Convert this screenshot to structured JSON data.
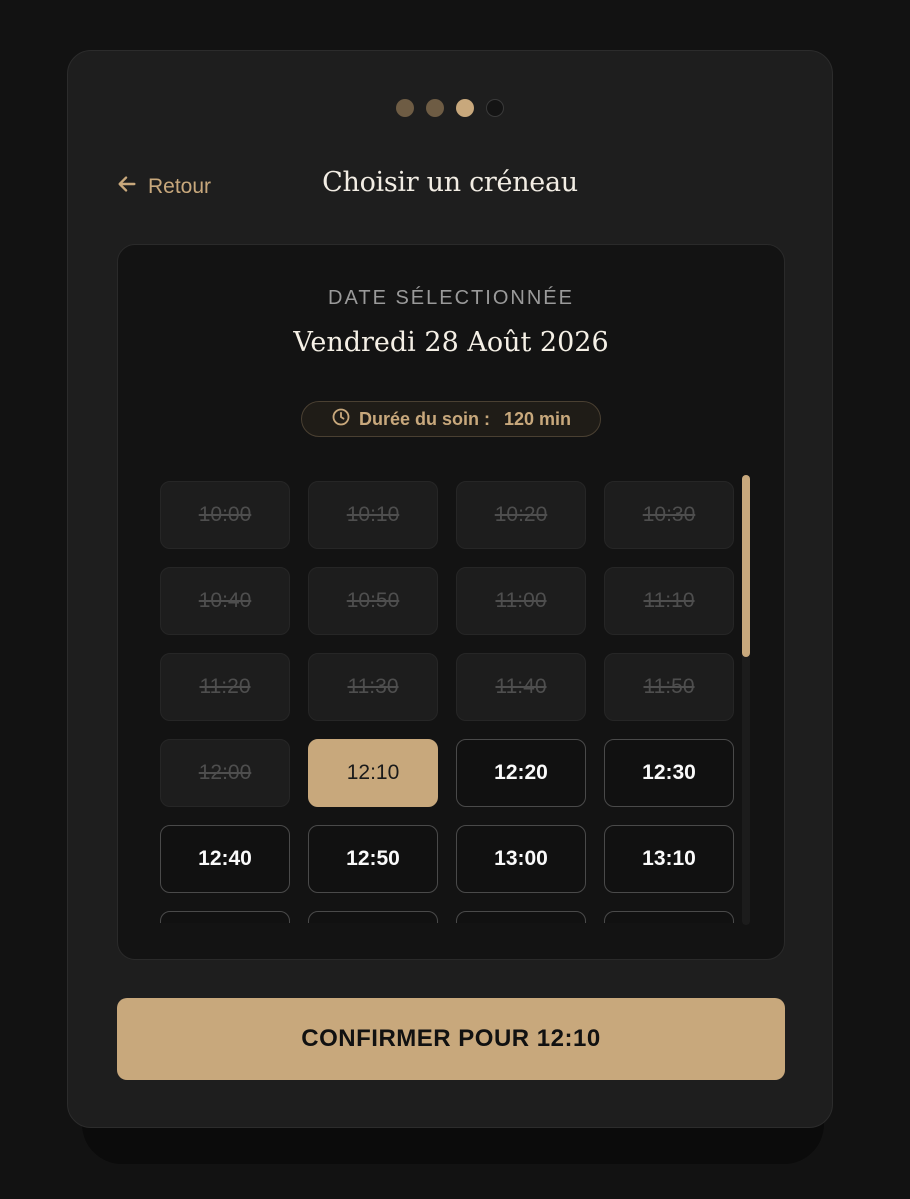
{
  "steps": [
    "done",
    "done",
    "active",
    "todo"
  ],
  "header": {
    "back_label": "Retour",
    "title": "Choisir un créneau"
  },
  "panel": {
    "date_label": "DATE SÉLECTIONNÉE",
    "date_value": "Vendredi 28 Août 2026",
    "duration_label": "Durée du soin :",
    "duration_value": "120 min"
  },
  "slots": [
    {
      "time": "10:00",
      "state": "disabled"
    },
    {
      "time": "10:10",
      "state": "disabled"
    },
    {
      "time": "10:20",
      "state": "disabled"
    },
    {
      "time": "10:30",
      "state": "disabled"
    },
    {
      "time": "10:40",
      "state": "disabled"
    },
    {
      "time": "10:50",
      "state": "disabled"
    },
    {
      "time": "11:00",
      "state": "disabled"
    },
    {
      "time": "11:10",
      "state": "disabled"
    },
    {
      "time": "11:20",
      "state": "disabled"
    },
    {
      "time": "11:30",
      "state": "disabled"
    },
    {
      "time": "11:40",
      "state": "disabled"
    },
    {
      "time": "11:50",
      "state": "disabled"
    },
    {
      "time": "12:00",
      "state": "disabled"
    },
    {
      "time": "12:10",
      "state": "selected"
    },
    {
      "time": "12:20",
      "state": "open"
    },
    {
      "time": "12:30",
      "state": "open"
    },
    {
      "time": "12:40",
      "state": "open"
    },
    {
      "time": "12:50",
      "state": "open"
    },
    {
      "time": "13:00",
      "state": "open"
    },
    {
      "time": "13:10",
      "state": "open"
    },
    {
      "time": "",
      "state": "open"
    },
    {
      "time": "",
      "state": "open"
    },
    {
      "time": "",
      "state": "open"
    },
    {
      "time": "",
      "state": "open"
    }
  ],
  "confirm_label": "CONFIRMER POUR 12:10",
  "colors": {
    "accent": "#c8a87c",
    "background": "#121212",
    "card": "#1e1e1e"
  }
}
